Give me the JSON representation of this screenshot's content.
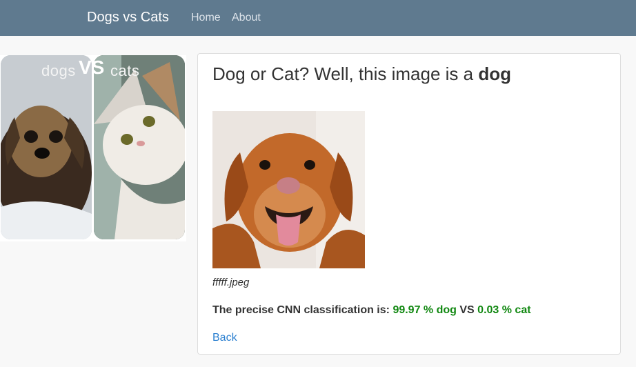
{
  "navbar": {
    "brand": "Dogs vs Cats",
    "links": [
      "Home",
      "About"
    ],
    "background": "#5f7a8f"
  },
  "hero": {
    "word_left": "dogs",
    "word_vs": "VS",
    "word_right": "cats"
  },
  "result": {
    "title_prefix": "Dog or Cat? Well, this image is a",
    "label": "dog",
    "filename": "fffff.jpeg",
    "classification_prefix": "The precise CNN classification is:",
    "dog_percent": "99.97 % dog",
    "vs": "VS",
    "cat_percent": "0.03 % cat",
    "accent_color": "#118811",
    "back_link": "Back"
  }
}
